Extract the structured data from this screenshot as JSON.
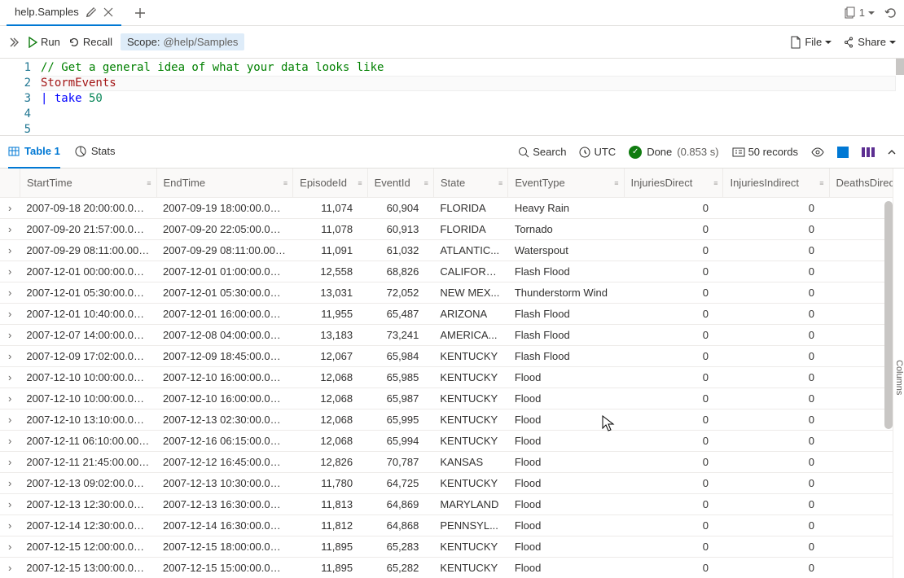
{
  "tabbar": {
    "active_tab": "help.Samples",
    "count": "1"
  },
  "toolbar": {
    "run": "Run",
    "recall": "Recall",
    "scope_label": "Scope:",
    "scope_value": "@help/Samples",
    "file": "File",
    "share": "Share"
  },
  "editor": {
    "lines": {
      "1": "1",
      "2": "2",
      "3": "3",
      "4": "4",
      "5": "5"
    },
    "code_comment": "// Get a general idea of what your data looks like",
    "code_ident": "StormEvents",
    "code_pipe": "| ",
    "code_kw": "take",
    "code_num": " 50"
  },
  "resultsbar": {
    "table1": "Table 1",
    "stats": "Stats",
    "search": "Search",
    "utc": "UTC",
    "done": "Done",
    "timing": "(0.853 s)",
    "records": "50 records"
  },
  "columns": {
    "c0": "StartTime",
    "c1": "EndTime",
    "c2": "EpisodeId",
    "c3": "EventId",
    "c4": "State",
    "c5": "EventType",
    "c6": "InjuriesDirect",
    "c7": "InjuriesIndirect",
    "c8": "DeathsDirect"
  },
  "rows": [
    {
      "st": "2007-09-18 20:00:00.0000",
      "et": "2007-09-19 18:00:00.0000",
      "ep": "11,074",
      "ev": "60,904",
      "state": "FLORIDA",
      "etype": "Heavy Rain",
      "id": "0",
      "ii": "0"
    },
    {
      "st": "2007-09-20 21:57:00.0000",
      "et": "2007-09-20 22:05:00.0000",
      "ep": "11,078",
      "ev": "60,913",
      "state": "FLORIDA",
      "etype": "Tornado",
      "id": "0",
      "ii": "0"
    },
    {
      "st": "2007-09-29 08:11:00.0000",
      "et": "2007-09-29 08:11:00.0000",
      "ep": "11,091",
      "ev": "61,032",
      "state": "ATLANTIC...",
      "etype": "Waterspout",
      "id": "0",
      "ii": "0"
    },
    {
      "st": "2007-12-01 00:00:00.0000",
      "et": "2007-12-01 01:00:00.0000",
      "ep": "12,558",
      "ev": "68,826",
      "state": "CALIFORN...",
      "etype": "Flash Flood",
      "id": "0",
      "ii": "0"
    },
    {
      "st": "2007-12-01 05:30:00.0000",
      "et": "2007-12-01 05:30:00.0000",
      "ep": "13,031",
      "ev": "72,052",
      "state": "NEW MEX...",
      "etype": "Thunderstorm Wind",
      "id": "0",
      "ii": "0"
    },
    {
      "st": "2007-12-01 10:40:00.0000",
      "et": "2007-12-01 16:00:00.0000",
      "ep": "11,955",
      "ev": "65,487",
      "state": "ARIZONA",
      "etype": "Flash Flood",
      "id": "0",
      "ii": "0"
    },
    {
      "st": "2007-12-07 14:00:00.0000",
      "et": "2007-12-08 04:00:00.0000",
      "ep": "13,183",
      "ev": "73,241",
      "state": "AMERICA...",
      "etype": "Flash Flood",
      "id": "0",
      "ii": "0"
    },
    {
      "st": "2007-12-09 17:02:00.0000",
      "et": "2007-12-09 18:45:00.0000",
      "ep": "12,067",
      "ev": "65,984",
      "state": "KENTUCKY",
      "etype": "Flash Flood",
      "id": "0",
      "ii": "0"
    },
    {
      "st": "2007-12-10 10:00:00.0000",
      "et": "2007-12-10 16:00:00.0000",
      "ep": "12,068",
      "ev": "65,985",
      "state": "KENTUCKY",
      "etype": "Flood",
      "id": "0",
      "ii": "0"
    },
    {
      "st": "2007-12-10 10:00:00.0000",
      "et": "2007-12-10 16:00:00.0000",
      "ep": "12,068",
      "ev": "65,987",
      "state": "KENTUCKY",
      "etype": "Flood",
      "id": "0",
      "ii": "0"
    },
    {
      "st": "2007-12-10 13:10:00.0000",
      "et": "2007-12-13 02:30:00.0000",
      "ep": "12,068",
      "ev": "65,995",
      "state": "KENTUCKY",
      "etype": "Flood",
      "id": "0",
      "ii": "0"
    },
    {
      "st": "2007-12-11 06:10:00.0000",
      "et": "2007-12-16 06:15:00.0000",
      "ep": "12,068",
      "ev": "65,994",
      "state": "KENTUCKY",
      "etype": "Flood",
      "id": "0",
      "ii": "0"
    },
    {
      "st": "2007-12-11 21:45:00.0000",
      "et": "2007-12-12 16:45:00.0000",
      "ep": "12,826",
      "ev": "70,787",
      "state": "KANSAS",
      "etype": "Flood",
      "id": "0",
      "ii": "0"
    },
    {
      "st": "2007-12-13 09:02:00.0000",
      "et": "2007-12-13 10:30:00.0000",
      "ep": "11,780",
      "ev": "64,725",
      "state": "KENTUCKY",
      "etype": "Flood",
      "id": "0",
      "ii": "0"
    },
    {
      "st": "2007-12-13 12:30:00.0000",
      "et": "2007-12-13 16:30:00.0000",
      "ep": "11,813",
      "ev": "64,869",
      "state": "MARYLAND",
      "etype": "Flood",
      "id": "0",
      "ii": "0"
    },
    {
      "st": "2007-12-14 12:30:00.0000",
      "et": "2007-12-14 16:30:00.0000",
      "ep": "11,812",
      "ev": "64,868",
      "state": "PENNSYL...",
      "etype": "Flood",
      "id": "0",
      "ii": "0"
    },
    {
      "st": "2007-12-15 12:00:00.0000",
      "et": "2007-12-15 18:00:00.0000",
      "ep": "11,895",
      "ev": "65,283",
      "state": "KENTUCKY",
      "etype": "Flood",
      "id": "0",
      "ii": "0"
    },
    {
      "st": "2007-12-15 13:00:00.0000",
      "et": "2007-12-15 15:00:00.0000",
      "ep": "11,895",
      "ev": "65,282",
      "state": "KENTUCKY",
      "etype": "Flood",
      "id": "0",
      "ii": "0"
    }
  ],
  "side_label": "Columns"
}
